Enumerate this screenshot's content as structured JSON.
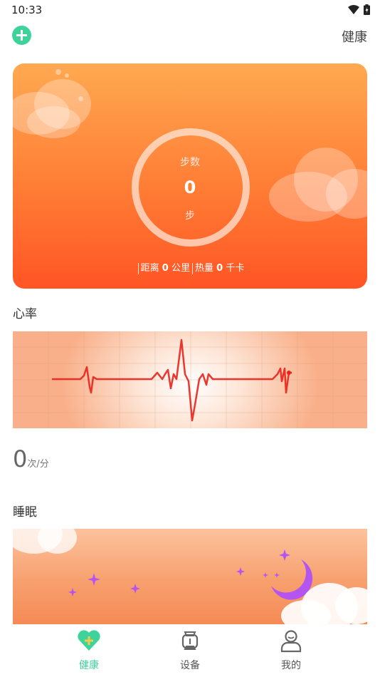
{
  "status_bar": {
    "time": "10:33"
  },
  "top_bar": {
    "title": "健康"
  },
  "steps_card": {
    "label": "步数",
    "value": "0",
    "unit": "步",
    "distance_label": "距离",
    "distance_value": "0",
    "distance_unit": "公里",
    "calories_label": "热量",
    "calories_value": "0",
    "calories_unit": "千卡"
  },
  "heart_rate": {
    "title": "心率",
    "value": "0",
    "unit": "次/分"
  },
  "sleep": {
    "title": "睡眠"
  },
  "bottom_nav": {
    "items": [
      {
        "label": "健康",
        "icon": "heart-icon",
        "active": true
      },
      {
        "label": "设备",
        "icon": "watch-icon",
        "active": false
      },
      {
        "label": "我的",
        "icon": "person-icon",
        "active": false
      }
    ]
  },
  "colors": {
    "accent": "#3ed39a",
    "card_orange_top": "#ffa951",
    "card_orange_bottom": "#ff5524",
    "ecg_line": "#e8221b",
    "star_purple": "#b455f0"
  }
}
